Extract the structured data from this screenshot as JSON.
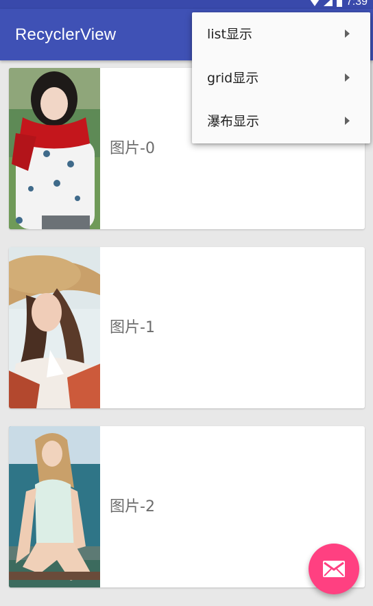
{
  "status_bar": {
    "time": "7:39",
    "icons": [
      "wifi-icon",
      "signal-icon",
      "battery-icon"
    ]
  },
  "app_bar": {
    "title": "RecyclerView",
    "color": "#3f51b5"
  },
  "list": {
    "items": [
      {
        "label": "图片-0",
        "image": "photo-woman-red-scarf"
      },
      {
        "label": "图片-1",
        "image": "photo-woman-straw-hat"
      },
      {
        "label": "图片-2",
        "image": "photo-woman-beach"
      }
    ]
  },
  "popup_menu": {
    "items": [
      {
        "label": "list显示",
        "icon": "submenu-arrow-icon"
      },
      {
        "label": "grid显示",
        "icon": "submenu-arrow-icon"
      },
      {
        "label": "瀑布显示",
        "icon": "submenu-arrow-icon"
      }
    ]
  },
  "fab": {
    "icon": "email-icon",
    "color": "#ff4081"
  }
}
